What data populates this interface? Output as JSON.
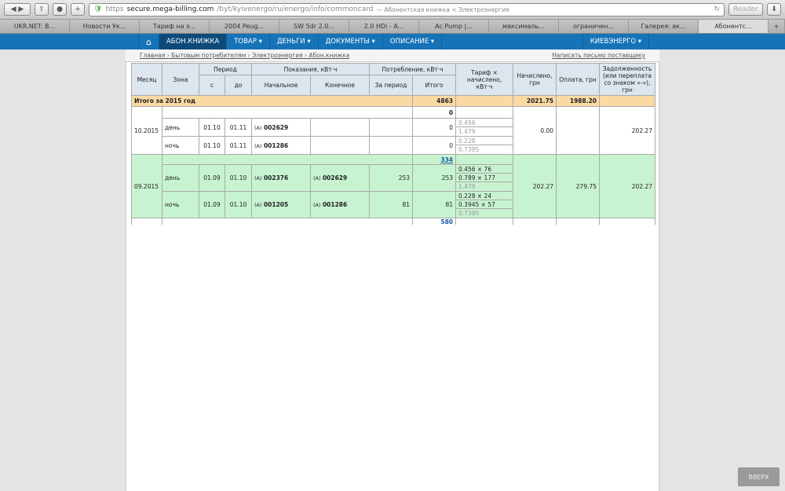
{
  "browser": {
    "url_scheme": "https",
    "url_domain": "secure.mega-billing.com",
    "url_path": "/byt/kyivenergo/ru/energo/info/commoncard",
    "page_title": "— Абонентская книжка < Электроэнергия",
    "reader": "Reader"
  },
  "tabs": [
    "UKR.NET: В...",
    "Новости Ук...",
    "Тариф на э...",
    "2004 Peug...",
    "SW 5dr 2.0...",
    "2.0 HDi - A...",
    "Ac Pump |...",
    "максималь...",
    "ограничен...",
    "Галерея: ак...",
    "Абонентс..."
  ],
  "nav": {
    "items": [
      "АБОН.КНИЖКА",
      "ТОВАР ▾",
      "ДЕНЬГИ ▾",
      "ДОКУМЕНТЫ ▾",
      "ОПИСАНИЕ ▾"
    ],
    "right": "КИЕВЭНЕРГО ▾"
  },
  "breadcrumb": {
    "path": "Главная › Бытовым потребителям › Электроэнергия › Абон.книжка",
    "write": "Написать письмо поставщику"
  },
  "table": {
    "headers": {
      "month": "Месяц",
      "zone": "Зона",
      "period": "Период",
      "from": "с",
      "to": "до",
      "readings": "Показания, кВт·ч",
      "start": "Начальное",
      "end": "Конечное",
      "consumption": "Потребление, кВт·ч",
      "per_period": "За период",
      "total": "Итого",
      "tariff": "Тариф × начислено, кВт·ч",
      "charged": "Начислено, грн",
      "paid": "Оплата, грн",
      "debt": "Задолженность (или переплата со знаком «-»), грн"
    },
    "year": {
      "label": "Итого за 2015 год",
      "total": "4863",
      "charged": "2021.75",
      "paid": "1988.20"
    },
    "m10": {
      "month": "10.2015",
      "total": "0",
      "charged": "0.00",
      "paid": "",
      "debt": "202.27",
      "day": {
        "zone": "день",
        "from": "01.10",
        "to": "01.11",
        "start_prefix": "(А)",
        "start": "002629",
        "total": "0",
        "t1": "0.456",
        "t2": "1.479"
      },
      "night": {
        "zone": "ночь",
        "from": "01.10",
        "to": "01.11",
        "start_prefix": "(А)",
        "start": "001286",
        "total": "0",
        "t1": "0.228",
        "t2": "0.7395"
      }
    },
    "m09": {
      "month": "09.2015",
      "total": "334",
      "charged": "202.27",
      "paid": "279.75",
      "debt": "202.27",
      "day": {
        "zone": "день",
        "from": "01.09",
        "to": "01.10",
        "start_prefix": "(А)",
        "start": "002376",
        "end_prefix": "(А)",
        "end": "002629",
        "period": "253",
        "total": "253",
        "t1": "0.456 × 76",
        "t2": "0.789 × 177",
        "t3": "1.479"
      },
      "night": {
        "zone": "ночь",
        "from": "01.09",
        "to": "01.10",
        "start_prefix": "(А)",
        "start": "001205",
        "end_prefix": "(А)",
        "end": "001286",
        "period": "81",
        "total": "81",
        "t1": "0.228 × 24",
        "t2": "0.3945 × 57",
        "t3": "0.7395"
      }
    },
    "next_total": "580"
  },
  "up_button": "ВВЕРХ"
}
